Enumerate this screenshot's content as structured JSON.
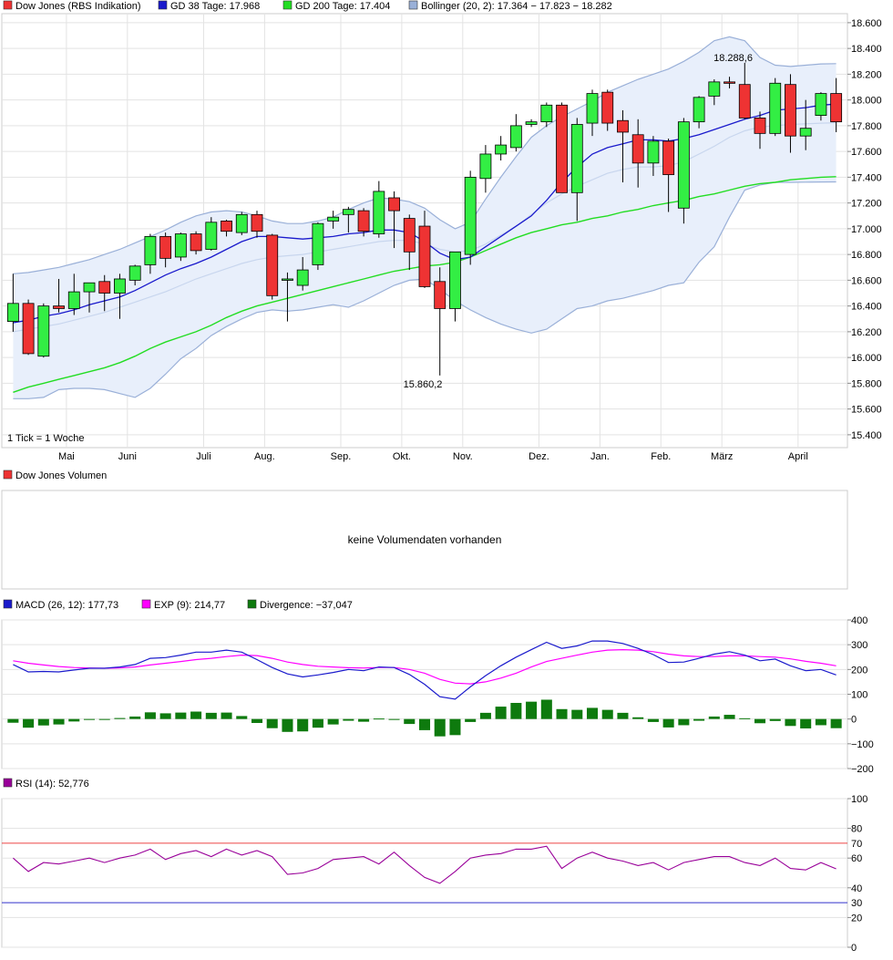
{
  "chart_data": [
    {
      "type": "candlestick",
      "legend": [
        {
          "label": "Dow Jones (RBS Indikation)",
          "color": "#ee3333"
        },
        {
          "label": "GD 38 Tage: 17.968",
          "color": "#1a1acc"
        },
        {
          "label": "GD 200 Tage: 17.404",
          "color": "#22dd22"
        },
        {
          "label": "Bollinger (20, 2): 17.364 − 17.823 − 18.282",
          "color": "#9ab0d8"
        }
      ],
      "y_ticks": [
        "18.600",
        "18.400",
        "18.200",
        "18.000",
        "17.800",
        "17.600",
        "17.400",
        "17.200",
        "17.000",
        "16.800",
        "16.600",
        "16.400",
        "16.200",
        "16.000",
        "15.800",
        "15.600",
        "15.400"
      ],
      "ylim": [
        15300,
        18670
      ],
      "x_labels": [
        "Mai",
        "Juni",
        "Juli",
        "Aug.",
        "Sep.",
        "Okt.",
        "Nov.",
        "Dez.",
        "Jan.",
        "Feb.",
        "März",
        "April"
      ],
      "x_label_weeks": [
        3.5,
        7.5,
        12.5,
        16.5,
        21.5,
        25.5,
        29.5,
        34.5,
        38.5,
        42.5,
        46.5,
        51.5
      ],
      "note": "1 Tick = 1 Woche",
      "annotations": [
        {
          "text": "18.288,6",
          "week": 47,
          "value": 18288.6
        },
        {
          "text": "15.860,2",
          "week": 27,
          "value": 15860.2
        }
      ],
      "candles": [
        {
          "o": 16280,
          "h": 16650,
          "l": 16200,
          "c": 16420
        },
        {
          "o": 16420,
          "h": 16450,
          "l": 16020,
          "c": 16030
        },
        {
          "o": 16010,
          "h": 16420,
          "l": 16000,
          "c": 16400
        },
        {
          "o": 16400,
          "h": 16610,
          "l": 16350,
          "c": 16380
        },
        {
          "o": 16380,
          "h": 16650,
          "l": 16330,
          "c": 16510
        },
        {
          "o": 16510,
          "h": 16580,
          "l": 16350,
          "c": 16580
        },
        {
          "o": 16590,
          "h": 16640,
          "l": 16360,
          "c": 16500
        },
        {
          "o": 16500,
          "h": 16650,
          "l": 16300,
          "c": 16610
        },
        {
          "o": 16600,
          "h": 16720,
          "l": 16560,
          "c": 16710
        },
        {
          "o": 16720,
          "h": 16960,
          "l": 16650,
          "c": 16940
        },
        {
          "o": 16940,
          "h": 16970,
          "l": 16700,
          "c": 16770
        },
        {
          "o": 16780,
          "h": 16970,
          "l": 16750,
          "c": 16960
        },
        {
          "o": 16960,
          "h": 16980,
          "l": 16800,
          "c": 16830
        },
        {
          "o": 16840,
          "h": 17090,
          "l": 16830,
          "c": 17050
        },
        {
          "o": 17060,
          "h": 17070,
          "l": 16940,
          "c": 16980
        },
        {
          "o": 16970,
          "h": 17130,
          "l": 16950,
          "c": 17110
        },
        {
          "o": 17110,
          "h": 17140,
          "l": 16930,
          "c": 16980
        },
        {
          "o": 16950,
          "h": 16960,
          "l": 16450,
          "c": 16480
        },
        {
          "o": 16610,
          "h": 16660,
          "l": 16280,
          "c": 16610
        },
        {
          "o": 16560,
          "h": 16780,
          "l": 16520,
          "c": 16680
        },
        {
          "o": 16720,
          "h": 17050,
          "l": 16680,
          "c": 17040
        },
        {
          "o": 17060,
          "h": 17140,
          "l": 17000,
          "c": 17090
        },
        {
          "o": 17110,
          "h": 17170,
          "l": 16970,
          "c": 17150
        },
        {
          "o": 17140,
          "h": 17160,
          "l": 16940,
          "c": 16980
        },
        {
          "o": 16960,
          "h": 17370,
          "l": 16930,
          "c": 17290
        },
        {
          "o": 17240,
          "h": 17290,
          "l": 16850,
          "c": 17140
        },
        {
          "o": 17080,
          "h": 17110,
          "l": 16680,
          "c": 16820
        },
        {
          "o": 17020,
          "h": 17140,
          "l": 16540,
          "c": 16550
        },
        {
          "o": 16590,
          "h": 16700,
          "l": 15860.2,
          "c": 16380
        },
        {
          "o": 16380,
          "h": 16820,
          "l": 16280,
          "c": 16820
        },
        {
          "o": 16800,
          "h": 17450,
          "l": 16720,
          "c": 17400
        },
        {
          "o": 17390,
          "h": 17650,
          "l": 17280,
          "c": 17580
        },
        {
          "o": 17580,
          "h": 17720,
          "l": 17530,
          "c": 17650
        },
        {
          "o": 17630,
          "h": 17890,
          "l": 17600,
          "c": 17800
        },
        {
          "o": 17810,
          "h": 17850,
          "l": 17790,
          "c": 17830
        },
        {
          "o": 17830,
          "h": 17980,
          "l": 17790,
          "c": 17960
        },
        {
          "o": 17960,
          "h": 17980,
          "l": 17280,
          "c": 17280
        },
        {
          "o": 17280,
          "h": 17860,
          "l": 17060,
          "c": 17810
        },
        {
          "o": 17820,
          "h": 18080,
          "l": 17720,
          "c": 18050
        },
        {
          "o": 18060,
          "h": 18080,
          "l": 17760,
          "c": 17820
        },
        {
          "o": 17840,
          "h": 17920,
          "l": 17360,
          "c": 17750
        },
        {
          "o": 17730,
          "h": 17850,
          "l": 17320,
          "c": 17510
        },
        {
          "o": 17510,
          "h": 17720,
          "l": 17410,
          "c": 17680
        },
        {
          "o": 17680,
          "h": 17700,
          "l": 17130,
          "c": 17420
        },
        {
          "o": 17160,
          "h": 17860,
          "l": 17040,
          "c": 17830
        },
        {
          "o": 17830,
          "h": 18030,
          "l": 17780,
          "c": 18020
        },
        {
          "o": 18030,
          "h": 18160,
          "l": 17960,
          "c": 18140
        },
        {
          "o": 18140,
          "h": 18180,
          "l": 18090,
          "c": 18130
        },
        {
          "o": 18120,
          "h": 18288.6,
          "l": 17850,
          "c": 17860
        },
        {
          "o": 17860,
          "h": 17910,
          "l": 17620,
          "c": 17740
        },
        {
          "o": 17740,
          "h": 18170,
          "l": 17720,
          "c": 18130
        },
        {
          "o": 18120,
          "h": 18200,
          "l": 17590,
          "c": 17720
        },
        {
          "o": 17720,
          "h": 18000,
          "l": 17610,
          "c": 17780
        },
        {
          "o": 17880,
          "h": 18060,
          "l": 17840,
          "c": 18050
        },
        {
          "o": 18050,
          "h": 18170,
          "l": 17750,
          "c": 17830
        }
      ],
      "series": [
        {
          "name": "GD 38 Tage",
          "color": "#1a1acc",
          "values": [
            16270,
            16290,
            16320,
            16340,
            16370,
            16410,
            16440,
            16470,
            16520,
            16580,
            16640,
            16690,
            16730,
            16780,
            16840,
            16900,
            16940,
            16940,
            16930,
            16920,
            16930,
            16940,
            16960,
            16970,
            16990,
            16990,
            16970,
            16900,
            16810,
            16760,
            16780,
            16860,
            16940,
            17020,
            17100,
            17220,
            17360,
            17480,
            17580,
            17630,
            17660,
            17690,
            17690,
            17680,
            17700,
            17730,
            17770,
            17810,
            17850,
            17880,
            17920,
            17930,
            17940,
            17960,
            17968
          ]
        },
        {
          "name": "GD 200 Tage",
          "color": "#22dd22",
          "values": [
            15730,
            15770,
            15800,
            15830,
            15860,
            15890,
            15920,
            15960,
            16010,
            16070,
            16120,
            16160,
            16200,
            16250,
            16310,
            16360,
            16400,
            16430,
            16460,
            16490,
            16520,
            16550,
            16580,
            16610,
            16640,
            16670,
            16690,
            16710,
            16720,
            16740,
            16780,
            16830,
            16880,
            16930,
            16970,
            17000,
            17030,
            17050,
            17080,
            17100,
            17130,
            17150,
            17180,
            17200,
            17220,
            17250,
            17270,
            17300,
            17330,
            17350,
            17360,
            17380,
            17390,
            17400,
            17404
          ]
        },
        {
          "name": "Bollinger Mitte",
          "color": "#c8d6ee",
          "values": [
            16200,
            16220,
            16240,
            16260,
            16290,
            16320,
            16350,
            16390,
            16430,
            16470,
            16510,
            16560,
            16610,
            16650,
            16690,
            16730,
            16760,
            16780,
            16790,
            16800,
            16820,
            16840,
            16860,
            16880,
            16900,
            16910,
            16910,
            16880,
            16840,
            16820,
            16830,
            16880,
            16950,
            17020,
            17110,
            17200,
            17270,
            17330,
            17380,
            17430,
            17460,
            17480,
            17480,
            17490,
            17520,
            17580,
            17640,
            17710,
            17760,
            17790,
            17800,
            17810,
            17815,
            17820,
            17823
          ]
        },
        {
          "name": "Bollinger oben",
          "color": "#9ab0d8",
          "values": [
            16650,
            16660,
            16680,
            16700,
            16730,
            16760,
            16800,
            16840,
            16890,
            16940,
            16990,
            17050,
            17100,
            17130,
            17140,
            17130,
            17100,
            17060,
            17040,
            17040,
            17060,
            17090,
            17150,
            17200,
            17240,
            17230,
            17210,
            17160,
            17070,
            17000,
            17050,
            17230,
            17400,
            17560,
            17710,
            17800,
            17870,
            17930,
            17990,
            18060,
            18110,
            18160,
            18200,
            18240,
            18300,
            18370,
            18460,
            18490,
            18460,
            18330,
            18270,
            18260,
            18270,
            18280,
            18282
          ]
        },
        {
          "name": "Bollinger unten",
          "color": "#9ab0d8",
          "values": [
            15680,
            15680,
            15690,
            15750,
            15760,
            15760,
            15750,
            15720,
            15690,
            15760,
            15870,
            15990,
            16070,
            16170,
            16240,
            16300,
            16350,
            16370,
            16360,
            16370,
            16390,
            16410,
            16390,
            16440,
            16500,
            16560,
            16600,
            16610,
            16530,
            16440,
            16370,
            16310,
            16260,
            16220,
            16190,
            16220,
            16300,
            16380,
            16400,
            16440,
            16460,
            16490,
            16520,
            16560,
            16580,
            16740,
            16860,
            17090,
            17300,
            17340,
            17360,
            17360,
            17362,
            17363,
            17364
          ]
        }
      ]
    },
    {
      "type": "bar",
      "legend": [
        {
          "label": "Dow Jones Volumen",
          "color": "#ee3333"
        }
      ],
      "message": "keine Volumendaten vorhanden"
    },
    {
      "type": "line",
      "legend": [
        {
          "label": "MACD (26, 12): 177,73",
          "color": "#1a1acc"
        },
        {
          "label": "EXP (9): 214,77",
          "color": "#ff00ff"
        },
        {
          "label": "Divergence: −37,047",
          "color": "#0e7a0e"
        }
      ],
      "y_ticks": [
        "400",
        "300",
        "200",
        "100",
        "0",
        "−100",
        "−200"
      ],
      "ylim": [
        -200,
        400
      ],
      "series": [
        {
          "name": "MACD",
          "color": "#1a1acc",
          "values": [
            220,
            190,
            192,
            190,
            198,
            205,
            205,
            210,
            220,
            245,
            248,
            258,
            270,
            270,
            278,
            270,
            240,
            208,
            182,
            170,
            178,
            188,
            200,
            195,
            210,
            208,
            180,
            140,
            90,
            80,
            130,
            175,
            215,
            250,
            280,
            310,
            285,
            295,
            315,
            315,
            305,
            285,
            260,
            228,
            230,
            245,
            262,
            272,
            258,
            235,
            242,
            215,
            195,
            200,
            178
          ]
        },
        {
          "name": "EXP (9)",
          "color": "#ff00ff",
          "values": [
            235,
            225,
            218,
            212,
            208,
            206,
            205,
            206,
            210,
            218,
            225,
            232,
            240,
            245,
            252,
            258,
            256,
            245,
            230,
            220,
            213,
            210,
            207,
            206,
            208,
            208,
            200,
            185,
            160,
            145,
            142,
            150,
            165,
            185,
            210,
            232,
            245,
            258,
            270,
            278,
            280,
            278,
            272,
            262,
            255,
            252,
            252,
            255,
            255,
            252,
            250,
            243,
            233,
            225,
            215
          ]
        },
        {
          "name": "Divergence",
          "color": "#0e7a0e",
          "values": [
            -15,
            -35,
            -26,
            -22,
            -10,
            -2,
            0,
            4,
            10,
            27,
            23,
            26,
            30,
            25,
            26,
            12,
            -16,
            -37,
            -52,
            -50,
            -35,
            -22,
            -7,
            -11,
            2,
            0,
            -20,
            -45,
            -70,
            -65,
            -12,
            25,
            50,
            65,
            70,
            78,
            40,
            37,
            45,
            37,
            25,
            7,
            -12,
            -34,
            -25,
            -7,
            10,
            17,
            3,
            -17,
            -8,
            -28,
            -38,
            -25,
            -37
          ]
        }
      ]
    },
    {
      "type": "line",
      "legend": [
        {
          "label": "RSI (14): 52,776",
          "color": "#990099"
        }
      ],
      "y_ticks": [
        "100",
        "80",
        "60",
        "40",
        "20",
        "0"
      ],
      "ref_lines": [
        {
          "label": "70",
          "value": 70,
          "color": "#ee4444"
        },
        {
          "label": "30",
          "value": 30,
          "color": "#3333cc"
        }
      ],
      "ylim": [
        0,
        100
      ],
      "series": [
        {
          "name": "RSI (14)",
          "color": "#990099",
          "values": [
            60,
            51,
            57,
            56,
            58,
            60,
            57,
            60,
            62,
            66,
            59,
            63,
            65,
            61,
            66,
            62,
            65,
            61,
            49,
            50,
            53,
            59,
            60,
            61,
            56,
            64,
            55,
            47,
            43,
            51,
            60,
            62,
            63,
            66,
            66,
            68,
            53,
            60,
            64,
            60,
            58,
            55,
            57,
            52,
            57,
            59,
            61,
            61,
            57,
            55,
            60,
            53,
            52,
            57,
            52.776
          ]
        }
      ]
    }
  ]
}
